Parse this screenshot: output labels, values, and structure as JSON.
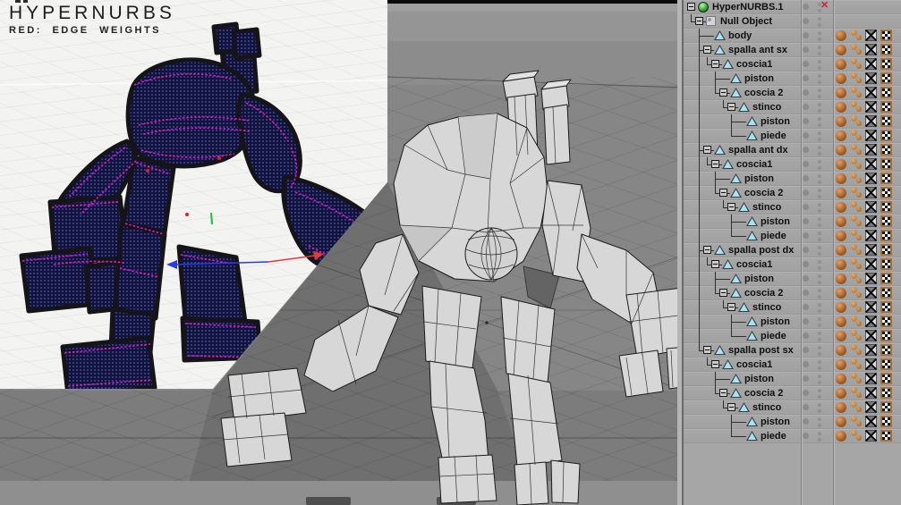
{
  "header": {
    "title": "HYPERNURBS",
    "subtitle": "RED: EDGE WEIGHTS"
  },
  "object_manager": {
    "disabled_marker": "✕",
    "tag_icons": [
      "phong-tag",
      "smoothing-spheres-tag",
      "projection-x-tag",
      "checker-texture-tag"
    ],
    "rows": [
      {
        "label": "HyperNURBS.1",
        "level": 0,
        "expandable": true,
        "icon": "hypernurbs-icon",
        "tags": false,
        "disabled": true
      },
      {
        "label": "Null Object",
        "level": 1,
        "expandable": true,
        "icon": "null-object-icon",
        "tags": false,
        "disabled": false
      },
      {
        "label": "body",
        "level": 2,
        "expandable": false,
        "icon": "polygon-object-icon",
        "tags": true,
        "disabled": false
      },
      {
        "label": "spalla ant sx",
        "level": 2,
        "expandable": true,
        "icon": "polygon-object-icon",
        "tags": true,
        "disabled": false
      },
      {
        "label": "coscia1",
        "level": 3,
        "expandable": true,
        "icon": "polygon-object-icon",
        "tags": true,
        "disabled": false
      },
      {
        "label": "piston",
        "level": 4,
        "expandable": false,
        "icon": "polygon-object-icon",
        "tags": true,
        "disabled": false
      },
      {
        "label": "coscia 2",
        "level": 4,
        "expandable": true,
        "icon": "polygon-object-icon",
        "tags": true,
        "disabled": false
      },
      {
        "label": "stinco",
        "level": 5,
        "expandable": true,
        "icon": "polygon-object-icon",
        "tags": true,
        "disabled": false
      },
      {
        "label": "piston",
        "level": 6,
        "expandable": false,
        "icon": "polygon-object-icon",
        "tags": true,
        "disabled": false
      },
      {
        "label": "piede",
        "level": 6,
        "expandable": false,
        "icon": "polygon-object-icon",
        "tags": true,
        "disabled": false
      },
      {
        "label": "spalla ant dx",
        "level": 2,
        "expandable": true,
        "icon": "polygon-object-icon",
        "tags": true,
        "disabled": false
      },
      {
        "label": "coscia1",
        "level": 3,
        "expandable": true,
        "icon": "polygon-object-icon",
        "tags": true,
        "disabled": false
      },
      {
        "label": "piston",
        "level": 4,
        "expandable": false,
        "icon": "polygon-object-icon",
        "tags": true,
        "disabled": false
      },
      {
        "label": "coscia 2",
        "level": 4,
        "expandable": true,
        "icon": "polygon-object-icon",
        "tags": true,
        "disabled": false
      },
      {
        "label": "stinco",
        "level": 5,
        "expandable": true,
        "icon": "polygon-object-icon",
        "tags": true,
        "disabled": false
      },
      {
        "label": "piston",
        "level": 6,
        "expandable": false,
        "icon": "polygon-object-icon",
        "tags": true,
        "disabled": false
      },
      {
        "label": "piede",
        "level": 6,
        "expandable": false,
        "icon": "polygon-object-icon",
        "tags": true,
        "disabled": false
      },
      {
        "label": "spalla post dx",
        "level": 2,
        "expandable": true,
        "icon": "polygon-object-icon",
        "tags": true,
        "disabled": false
      },
      {
        "label": "coscia1",
        "level": 3,
        "expandable": true,
        "icon": "polygon-object-icon",
        "tags": true,
        "disabled": false
      },
      {
        "label": "piston",
        "level": 4,
        "expandable": false,
        "icon": "polygon-object-icon",
        "tags": true,
        "disabled": false
      },
      {
        "label": "coscia 2",
        "level": 4,
        "expandable": true,
        "icon": "polygon-object-icon",
        "tags": true,
        "disabled": false
      },
      {
        "label": "stinco",
        "level": 5,
        "expandable": true,
        "icon": "polygon-object-icon",
        "tags": true,
        "disabled": false
      },
      {
        "label": "piston",
        "level": 6,
        "expandable": false,
        "icon": "polygon-object-icon",
        "tags": true,
        "disabled": false
      },
      {
        "label": "piede",
        "level": 6,
        "expandable": false,
        "icon": "polygon-object-icon",
        "tags": true,
        "disabled": false
      },
      {
        "label": "spalla post sx",
        "level": 2,
        "expandable": true,
        "icon": "polygon-object-icon",
        "tags": true,
        "disabled": false
      },
      {
        "label": "coscia1",
        "level": 3,
        "expandable": true,
        "icon": "polygon-object-icon",
        "tags": true,
        "disabled": false
      },
      {
        "label": "piston",
        "level": 4,
        "expandable": false,
        "icon": "polygon-object-icon",
        "tags": true,
        "disabled": false
      },
      {
        "label": "coscia 2",
        "level": 4,
        "expandable": true,
        "icon": "polygon-object-icon",
        "tags": true,
        "disabled": false
      },
      {
        "label": "stinco",
        "level": 5,
        "expandable": true,
        "icon": "polygon-object-icon",
        "tags": true,
        "disabled": false
      },
      {
        "label": "piston",
        "level": 6,
        "expandable": false,
        "icon": "polygon-object-icon",
        "tags": true,
        "disabled": false
      },
      {
        "label": "piede",
        "level": 6,
        "expandable": false,
        "icon": "polygon-object-icon",
        "tags": true,
        "disabled": false
      }
    ]
  },
  "colors": {
    "wire_blue": "#2633e0",
    "edge_weight_magenta": "#ea1ac8",
    "edge_weight_red": "#e02028",
    "axis_blue": "#2a3ae8",
    "axis_red": "#e03a3a",
    "axis_green": "#12c23a",
    "panel_bg": "#a6a6a6",
    "viewport_gray": "#868686",
    "inset_bg": "#f3f3f1",
    "object_triangle_blue": "#a6e3f7",
    "hypernurbs_green": "#4db54d",
    "disabled_red": "#c22434",
    "tag_brown": "#b3763c"
  }
}
